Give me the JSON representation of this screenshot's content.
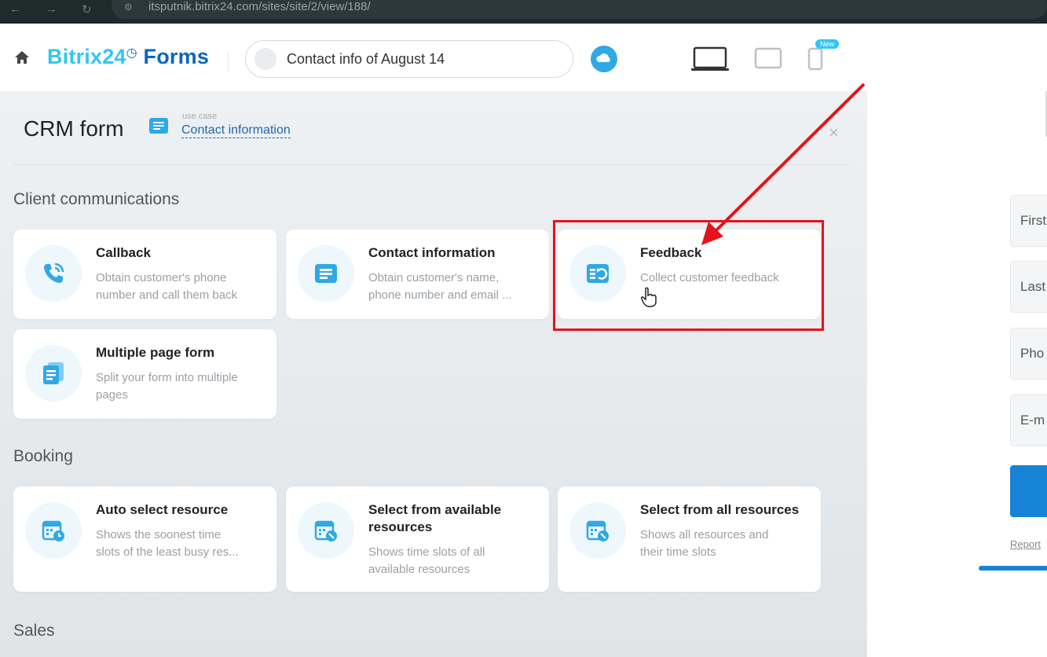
{
  "browser": {
    "back": "←",
    "forward": "→",
    "reload": "↻",
    "url": "itsputnik.bitrix24.com/sites/site/2/view/188/"
  },
  "header": {
    "brand_name": "Bitrix24",
    "brand_suffix": "Forms",
    "brand_clock": "◷",
    "form_title": "Contact info of August 14",
    "new_badge": "New"
  },
  "panel": {
    "title": "CRM form",
    "use_case_label": "use case",
    "use_case_value": "Contact information",
    "close": "×"
  },
  "sections": {
    "client_communications": {
      "title": "Client communications",
      "cards": [
        {
          "title": "Callback",
          "desc": "Obtain customer's phone\nnumber and call them back",
          "icon": "phone-icon"
        },
        {
          "title": "Contact information",
          "desc": "Obtain customer's name,\nphone number and email ...",
          "icon": "contact-card-icon"
        },
        {
          "title": "Feedback",
          "desc": "Collect customer feedback",
          "icon": "feedback-icon"
        },
        {
          "title": "Multiple page form",
          "desc": "Split your form into multiple\npages",
          "icon": "multi-page-icon"
        }
      ]
    },
    "booking": {
      "title": "Booking",
      "cards": [
        {
          "title": "Auto select resource",
          "desc": "Shows the soonest time\nslots of the least busy res...",
          "icon": "calendar-icon"
        },
        {
          "title": "Select from available resources",
          "desc": "Shows time slots of all\navailable resources",
          "icon": "calendar-icon"
        },
        {
          "title": "Select from all resources",
          "desc": "Shows all resources and\ntheir time slots",
          "icon": "calendar-icon"
        }
      ]
    },
    "sales": {
      "title": "Sales"
    }
  },
  "preview": {
    "fields": [
      "First",
      "Last",
      "Pho",
      "E-m"
    ],
    "report": "Report"
  },
  "colors": {
    "accent": "#2fc6f6",
    "brand_dark": "#0b66c3",
    "highlight": "#e4131c",
    "link": "#2067b0"
  }
}
